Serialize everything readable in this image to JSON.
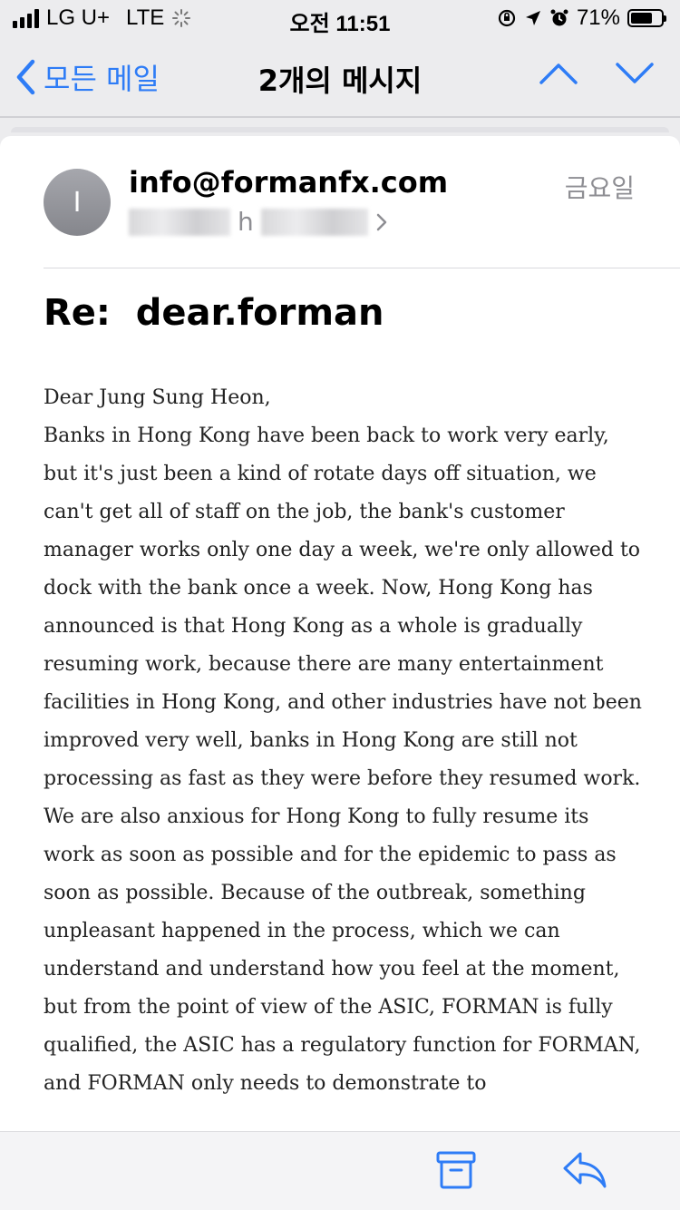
{
  "status_bar": {
    "carrier": "LG U+",
    "network": "LTE",
    "time": "오전 11:51",
    "battery_percent": "71%",
    "battery_level": 0.71
  },
  "nav": {
    "back_label": "모든 메일",
    "title": "2개의 메시지"
  },
  "email": {
    "avatar_initial": "I",
    "sender": "info@formanfx.com",
    "day": "금요일",
    "recipient_visible": "h",
    "subject": "Re:  dear.forman",
    "greeting": "Dear Jung Sung Heon,",
    "paragraph1": "Banks in Hong Kong have been back to work very early, but it's just been a kind of rotate days off situation, we can't get all of staff on the job, the bank's customer manager works only one day a week, we're only allowed to dock with the bank once a week. Now, Hong Kong has announced is that Hong Kong as a whole is gradually resuming work, because there are many entertainment facilities in Hong Kong, and other industries have not been improved very well, banks in Hong Kong are still not processing as fast as they were before they resumed work.",
    "paragraph2": "We are also anxious for Hong Kong to fully resume its work as soon as possible and for the epidemic to pass as soon as possible. Because of the outbreak, something unpleasant happened in the process, which we can understand and understand how you feel at the moment, but from the point of view of the ASIC, FORMAN is fully qualified, the ASIC has a regulatory function for FORMAN, and FORMAN only needs to demonstrate to"
  },
  "colors": {
    "accent": "#2e7cf6",
    "secondary_text": "#8e8e93"
  },
  "icons": {
    "back": "chevron-left-icon",
    "prev": "chevron-up-icon",
    "next": "chevron-down-icon",
    "archive": "archive-box-icon",
    "reply": "reply-arrow-icon"
  }
}
